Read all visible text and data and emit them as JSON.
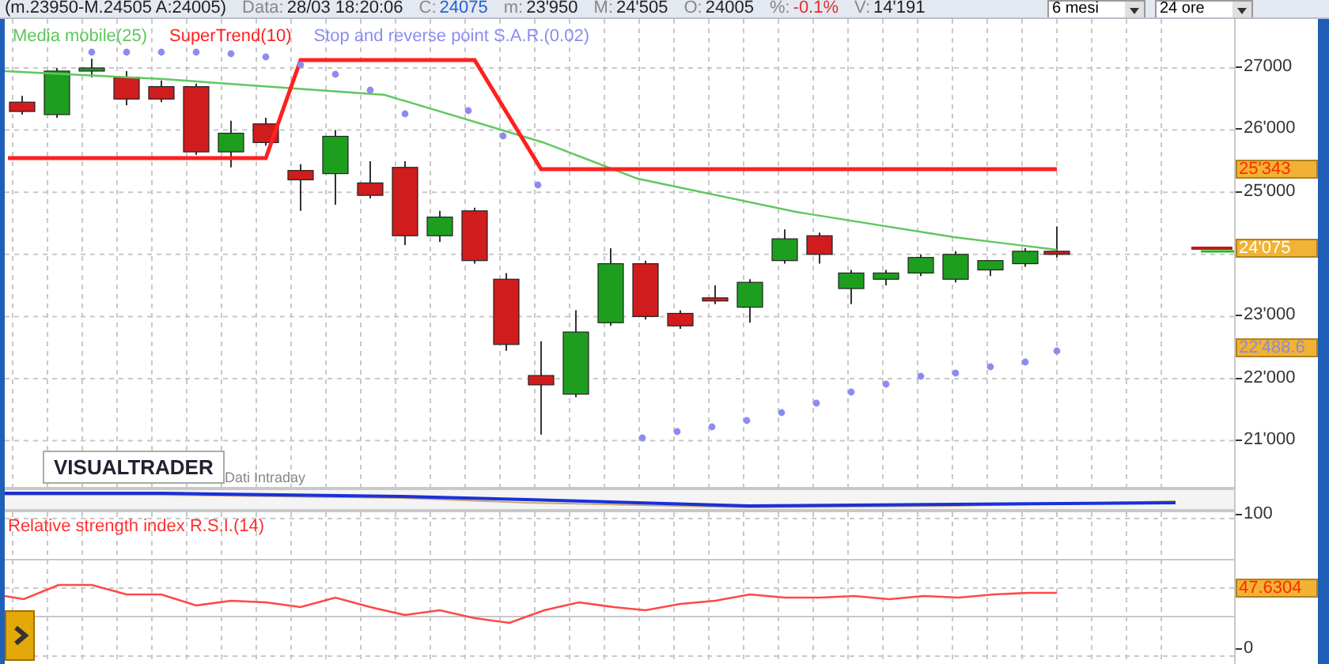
{
  "header": {
    "range": "(m.23950-M.24505 A:24005)",
    "fields": [
      {
        "label": "Data:",
        "value": "28/03 18:20:06",
        "color": "#222222"
      },
      {
        "label": "C:",
        "value": "24075",
        "color": "#1f5fd8"
      },
      {
        "label": "m:",
        "value": "23'950",
        "color": "#222222"
      },
      {
        "label": "M:",
        "value": "24'505",
        "color": "#222222"
      },
      {
        "label": "O:",
        "value": "24005",
        "color": "#222222"
      },
      {
        "label": "%:",
        "value": "-0.1%",
        "color": "#e03030"
      },
      {
        "label": "V:",
        "value": "14'191",
        "color": "#222222"
      }
    ],
    "dropdowns": [
      {
        "value": "6 mesi"
      },
      {
        "value": "24 ore"
      }
    ]
  },
  "main_pane": {
    "legend": [
      {
        "name": "Media mobile(25)",
        "color": "#5ec85e"
      },
      {
        "name": "SuperTrend(10)",
        "color": "#ff2020"
      },
      {
        "name": "Stop and reverse point S.A.R.(0.02)",
        "color": "#8c8cf0"
      }
    ],
    "logo": "VISUALTRADER",
    "source": "Dati Intraday",
    "axis": [
      "27000",
      "26'000",
      "25'000",
      "23'000",
      "22'000",
      "21'000"
    ],
    "badges": [
      {
        "value": "25'343",
        "kind": "supertrend"
      },
      {
        "value": "24'075",
        "kind": "last"
      },
      {
        "value": "22'488.6",
        "kind": "sar"
      }
    ]
  },
  "rsi_pane": {
    "title": "Relative strength index R.S.I.(14)",
    "axis": [
      "100",
      "0"
    ],
    "badge": "47.6304"
  }
}
